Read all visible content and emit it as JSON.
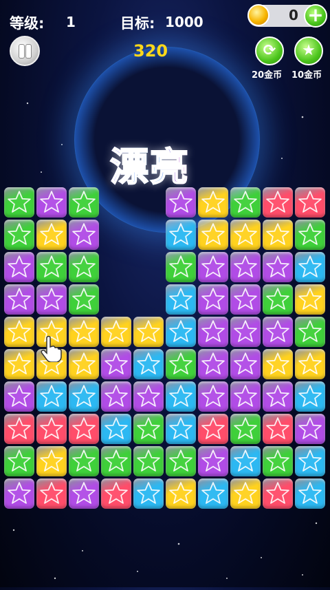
{
  "hud": {
    "level_label": "等级:",
    "level_value": "1",
    "target_label": "目标:",
    "target_value": "1000",
    "score": "320"
  },
  "coins": {
    "value": "0",
    "add_label": "+"
  },
  "tools": [
    {
      "name": "refresh",
      "label": "20金币",
      "glyph": "⟳"
    },
    {
      "name": "color-change",
      "label": "10金币",
      "glyph": "★"
    }
  ],
  "title_banner": "漂亮",
  "colors": {
    "green": "#3fd03a",
    "purple": "#b14ce6",
    "yellow": "#ffd21f",
    "blue": "#2cb8f2",
    "red": "#ff4d6a"
  },
  "board": {
    "columns": 10,
    "rows": 10,
    "grid": [
      [
        "green",
        "purple",
        "green",
        "",
        "",
        "purple",
        "yellow",
        "green",
        "red",
        "red"
      ],
      [
        "green",
        "yellow",
        "purple",
        "",
        "",
        "blue",
        "yellow",
        "yellow",
        "yellow",
        "green"
      ],
      [
        "purple",
        "green",
        "green",
        "",
        "",
        "green",
        "purple",
        "purple",
        "purple",
        "blue"
      ],
      [
        "purple",
        "purple",
        "green",
        "",
        "",
        "blue",
        "purple",
        "purple",
        "green",
        "yellow"
      ],
      [
        "yellow",
        "yellow",
        "yellow",
        "yellow",
        "yellow",
        "blue",
        "purple",
        "purple",
        "purple",
        "green"
      ],
      [
        "yellow",
        "yellow",
        "yellow",
        "purple",
        "blue",
        "green",
        "purple",
        "purple",
        "yellow",
        "yellow"
      ],
      [
        "purple",
        "blue",
        "blue",
        "purple",
        "purple",
        "blue",
        "purple",
        "purple",
        "purple",
        "blue"
      ],
      [
        "red",
        "red",
        "red",
        "blue",
        "green",
        "blue",
        "red",
        "green",
        "red",
        "purple"
      ],
      [
        "green",
        "yellow",
        "green",
        "green",
        "green",
        "green",
        "purple",
        "blue",
        "green",
        "blue"
      ],
      [
        "purple",
        "red",
        "purple",
        "red",
        "blue",
        "yellow",
        "blue",
        "yellow",
        "red",
        "blue"
      ]
    ]
  }
}
